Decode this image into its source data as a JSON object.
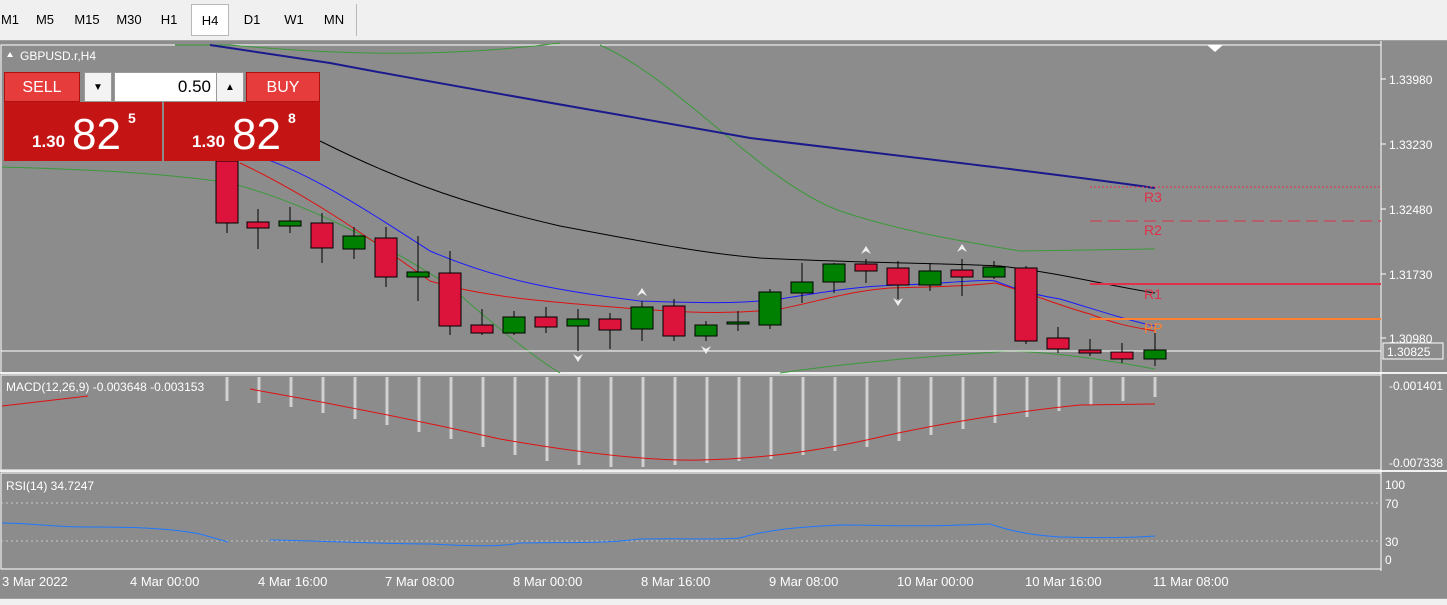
{
  "timeframes": [
    "M1",
    "M5",
    "M15",
    "M30",
    "H1",
    "H4",
    "D1",
    "W1",
    "MN"
  ],
  "active_timeframe": "H4",
  "chart": {
    "symbol_label": "GBPUSD.r,H4",
    "price_labels": [
      "1.33980",
      "1.33230",
      "1.32480",
      "1.31730",
      "1.30980"
    ],
    "current_price_label": "1.30825",
    "pivots": [
      "R3",
      "R2",
      "R1",
      "PP"
    ],
    "pivot_colors": {
      "R3": "#e0304a",
      "R2": "#e0304a",
      "R1": "#e0304a",
      "PP": "#ff8030"
    },
    "time_labels": [
      "3 Mar 2022",
      "4 Mar 00:00",
      "4 Mar 16:00",
      "7 Mar 08:00",
      "8 Mar 00:00",
      "8 Mar 16:00",
      "9 Mar 08:00",
      "10 Mar 00:00",
      "10 Mar 16:00",
      "11 Mar 08:00"
    ],
    "colors": {
      "bull": "#008000",
      "bear": "#dc143c",
      "ma_slow": "#1a1a8c",
      "ma_mid": "#000000",
      "ma_fast": "#1a1aff",
      "ma_red": "#e01010",
      "bands": "#3a9a3a"
    }
  },
  "trade_panel": {
    "sell_label": "SELL",
    "buy_label": "BUY",
    "lot": "0.50",
    "sell_price": {
      "prefix": "1.30",
      "big": "82",
      "sup": "5"
    },
    "buy_price": {
      "prefix": "1.30",
      "big": "82",
      "sup": "8"
    }
  },
  "macd": {
    "label": "MACD(12,26,9) -0.003648 -0.003153",
    "levels": [
      "-0.001401",
      "-0.007338"
    ]
  },
  "rsi": {
    "label": "RSI(14) 34.7247",
    "levels": [
      "100",
      "70",
      "30",
      "0"
    ]
  }
}
